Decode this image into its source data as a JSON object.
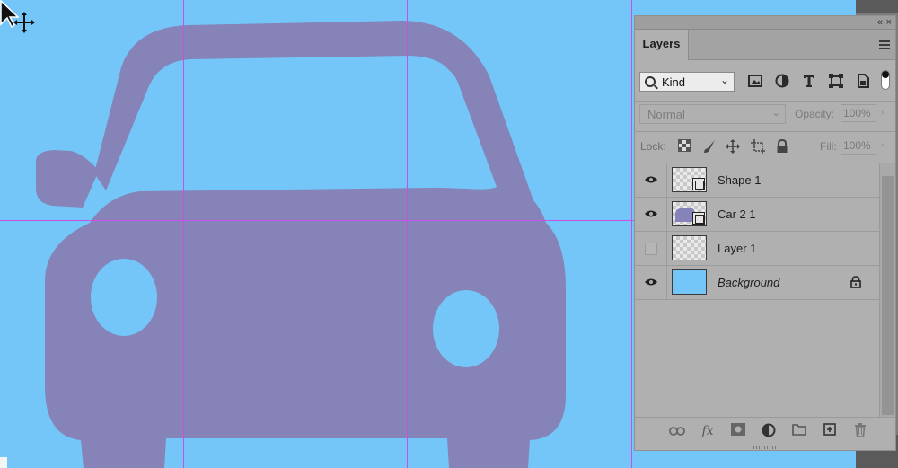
{
  "canvas": {
    "background": "#74c6f8",
    "shape_fill": "#8683b8",
    "guide_color": "#c651e6"
  },
  "panel": {
    "tab_label": "Layers",
    "collapse_glyph": "«",
    "close_glyph": "×"
  },
  "filter": {
    "kind_label": "Kind",
    "icons": [
      "image-filter-icon",
      "adjustment-filter-icon",
      "type-filter-icon",
      "shape-filter-icon",
      "smart-object-filter-icon"
    ]
  },
  "blend": {
    "mode": "Normal",
    "opacity_label": "Opacity:",
    "opacity_value": "100%"
  },
  "lock": {
    "label": "Lock:",
    "fill_label": "Fill:",
    "fill_value": "100%"
  },
  "layers": [
    {
      "name": "Shape 1",
      "visible": true,
      "thumb": "transparent-vector"
    },
    {
      "name": "Car 2 1",
      "visible": true,
      "thumb": "car-vector"
    },
    {
      "name": "Layer 1",
      "visible": false,
      "thumb": "transparent"
    },
    {
      "name": "Background",
      "visible": true,
      "thumb": "solid",
      "locked": true
    }
  ]
}
